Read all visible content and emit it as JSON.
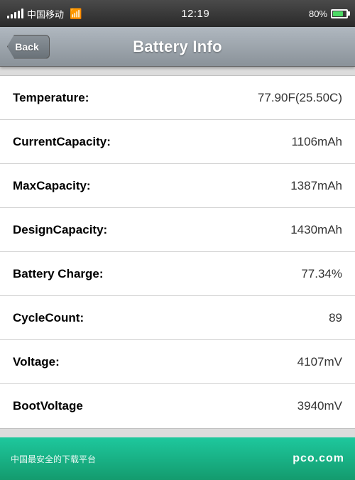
{
  "statusBar": {
    "carrier": "中国移动",
    "time": "12:19",
    "battery": "80%"
  },
  "navBar": {
    "backLabel": "Back",
    "title": "Battery Info"
  },
  "rows": [
    {
      "label": "Temperature:",
      "value": "77.90F(25.50C)"
    },
    {
      "label": "CurrentCapacity:",
      "value": "1106mAh"
    },
    {
      "label": "MaxCapacity:",
      "value": "1387mAh"
    },
    {
      "label": "DesignCapacity:",
      "value": "1430mAh"
    },
    {
      "label": "Battery Charge:",
      "value": "77.34%"
    },
    {
      "label": "CycleCount:",
      "value": "89"
    },
    {
      "label": "Voltage:",
      "value": "4107mV"
    },
    {
      "label": "BootVoltage",
      "value": "3940mV"
    }
  ],
  "watermark": {
    "text": "中国最安全的下载平台",
    "logo": "pco.com"
  }
}
